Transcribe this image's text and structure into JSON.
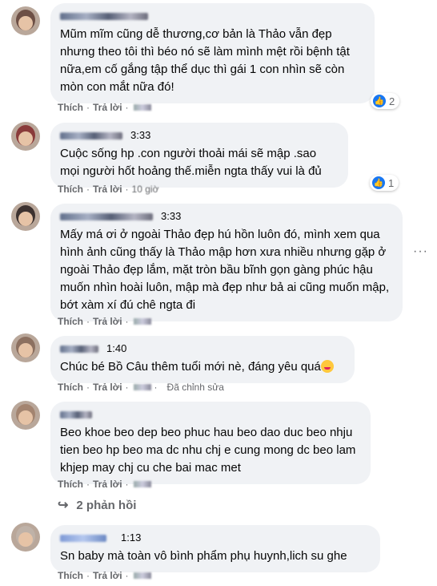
{
  "comments": [
    {
      "name_hidden": true,
      "timestamp": "",
      "text": "Mũm mĩm cũng dễ thương,cơ bản là Thảo vẫn đẹp nhưng theo tôi thì béo nó sẽ làm mình mệt rồi bệnh tật nữa,em cố gắng tập thể dục thì gái 1 con nhìn sẽ còn mòn con mắt nữa đó!",
      "reactions": "2"
    },
    {
      "name_hidden": true,
      "timestamp": "3:33",
      "text": "Cuộc sống hp .con người thoải mái sẽ mập .sao mọi người hốt hoảng thế.miễn ngta thấy vui là đủ",
      "reactions": "1",
      "time_ago": "10 giờ"
    },
    {
      "name_hidden": true,
      "timestamp": "3:33",
      "text": "Mấy má ơi ở ngoài Thảo đẹp hú hồn luôn đó, mình xem qua hình ảnh cũng thấy là Thảo mập hơn xưa nhiều nhưng gặp ở ngoài Thảo đẹp lắm, mặt tròn bầu bĩnh gọn gàng phúc hậu muốn nhìn hoài luôn, mập mà đẹp như bả ai cũng muốn mập, bớt xàm xí đú chê ngta đi"
    },
    {
      "name_hidden": true,
      "timestamp": "1:40",
      "text": "Chúc bé Bồ Câu thêm tuổi mới nè, đáng yêu quá",
      "edited": "Đã chỉnh sửa"
    },
    {
      "name_hidden": true,
      "timestamp": "",
      "text": "Beo khoe beo dep beo phuc hau beo dao duc beo nhju tien beo hp beo ma dc nhu chj e cung mong dc beo lam khjep may chj cu che bai mac met"
    },
    {
      "name_hidden": true,
      "timestamp": "1:13",
      "text": "Sn baby mà toàn vô bình phẩm phụ huynh,lich su ghe"
    }
  ],
  "actions": {
    "like": "Thích",
    "reply": "Trả lời",
    "sep": "·"
  },
  "replies_link": "2 phản hồi",
  "more_icon": "more-horizontal-icon"
}
